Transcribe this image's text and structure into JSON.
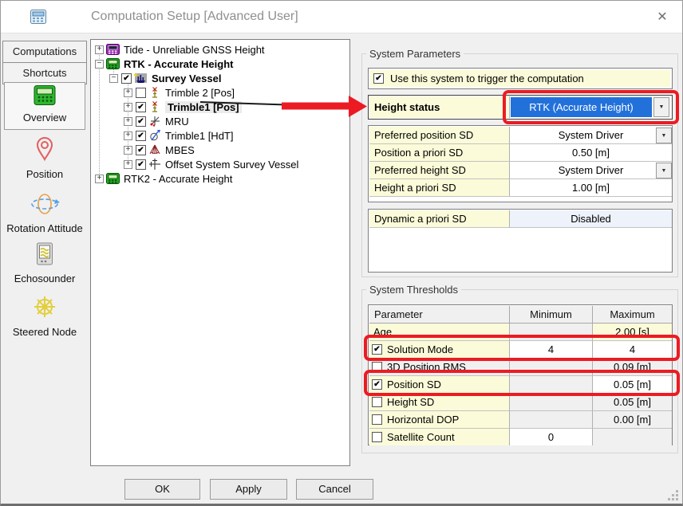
{
  "window": {
    "title": "Computation Setup [Advanced User]",
    "close_glyph": "✕"
  },
  "sidebar": {
    "tabs": [
      {
        "label": "Computations"
      },
      {
        "label": "Shortcuts"
      }
    ],
    "shortcuts": [
      {
        "label": "Overview",
        "selected": true
      },
      {
        "label": "Position",
        "selected": false
      },
      {
        "label": "Rotation Attitude",
        "selected": false
      },
      {
        "label": "Echosounder",
        "selected": false
      },
      {
        "label": "Steered Node",
        "selected": false
      }
    ]
  },
  "tree": {
    "items": [
      {
        "label": "Tide - Unreliable GNSS Height",
        "expander": "+"
      },
      {
        "label": "RTK - Accurate Height",
        "expander": "−"
      },
      {
        "label": "Survey Vessel",
        "expander": "−",
        "check": "✔"
      },
      {
        "label": "Trimble 2 [Pos]",
        "expander": "+",
        "check": ""
      },
      {
        "label": "Trimble1 [Pos]",
        "expander": "+",
        "check": "✔",
        "selected": true
      },
      {
        "label": "MRU",
        "expander": "+",
        "check": "✔"
      },
      {
        "label": "Trimble1 [HdT]",
        "expander": "+",
        "check": "✔"
      },
      {
        "label": "MBES",
        "expander": "+",
        "check": "✔"
      },
      {
        "label": "Offset System Survey Vessel",
        "expander": "+",
        "check": "✔"
      },
      {
        "label": "RTK2 - Accurate Height",
        "expander": "+"
      }
    ]
  },
  "system_parameters": {
    "group_title": "System Parameters",
    "trigger": {
      "check": "✔",
      "label": "Use this system to trigger the computation"
    },
    "height_status": {
      "label": "Height status",
      "value": "RTK (Accurate Height)",
      "arrow_glyph": "▼"
    },
    "sd_rows": [
      {
        "label": "Preferred position SD",
        "value": "System Driver",
        "dropdown": true,
        "arrow_glyph": "▼"
      },
      {
        "label": "Position a priori SD",
        "value": "0.50 [m]",
        "dropdown": false
      },
      {
        "label": "Preferred height SD",
        "value": "System Driver",
        "dropdown": true,
        "arrow_glyph": "▼"
      },
      {
        "label": "Height a priori SD",
        "value": "1.00 [m]",
        "dropdown": false
      }
    ],
    "dynamic_row": {
      "label": "Dynamic a priori SD",
      "value": "Disabled"
    }
  },
  "system_thresholds": {
    "group_title": "System Thresholds",
    "columns": {
      "param": "Parameter",
      "min": "Minimum",
      "max": "Maximum"
    },
    "rows": [
      {
        "param": "Age",
        "min": "",
        "max": "2.00 [s]"
      },
      {
        "param": "Solution Mode",
        "check": "✔",
        "min": "4",
        "max": "4",
        "annotated": true
      },
      {
        "param": "3D Position RMS",
        "check": "",
        "min": "",
        "max": "0.09 [m]"
      },
      {
        "param": "Position SD",
        "check": "✔",
        "min": "",
        "max": "0.05 [m]",
        "annotated": true
      },
      {
        "param": "Height SD",
        "check": "",
        "min": "",
        "max": "0.05 [m]"
      },
      {
        "param": "Horizontal DOP",
        "check": "",
        "min": "",
        "max": "0.00 [m]"
      },
      {
        "param": "Satellite Count",
        "check": "",
        "min": "0",
        "max": ""
      }
    ]
  },
  "footer": {
    "buttons": [
      {
        "label": "OK"
      },
      {
        "label": "Apply"
      },
      {
        "label": "Cancel"
      }
    ]
  },
  "colors": {
    "annotation_red": "#ec1b23",
    "selection_blue": "#2271da",
    "editable_yellow": "#fbfbd9",
    "disabled_gray": "#f0f0f0",
    "dialog_bg": "#f0f0f0"
  }
}
